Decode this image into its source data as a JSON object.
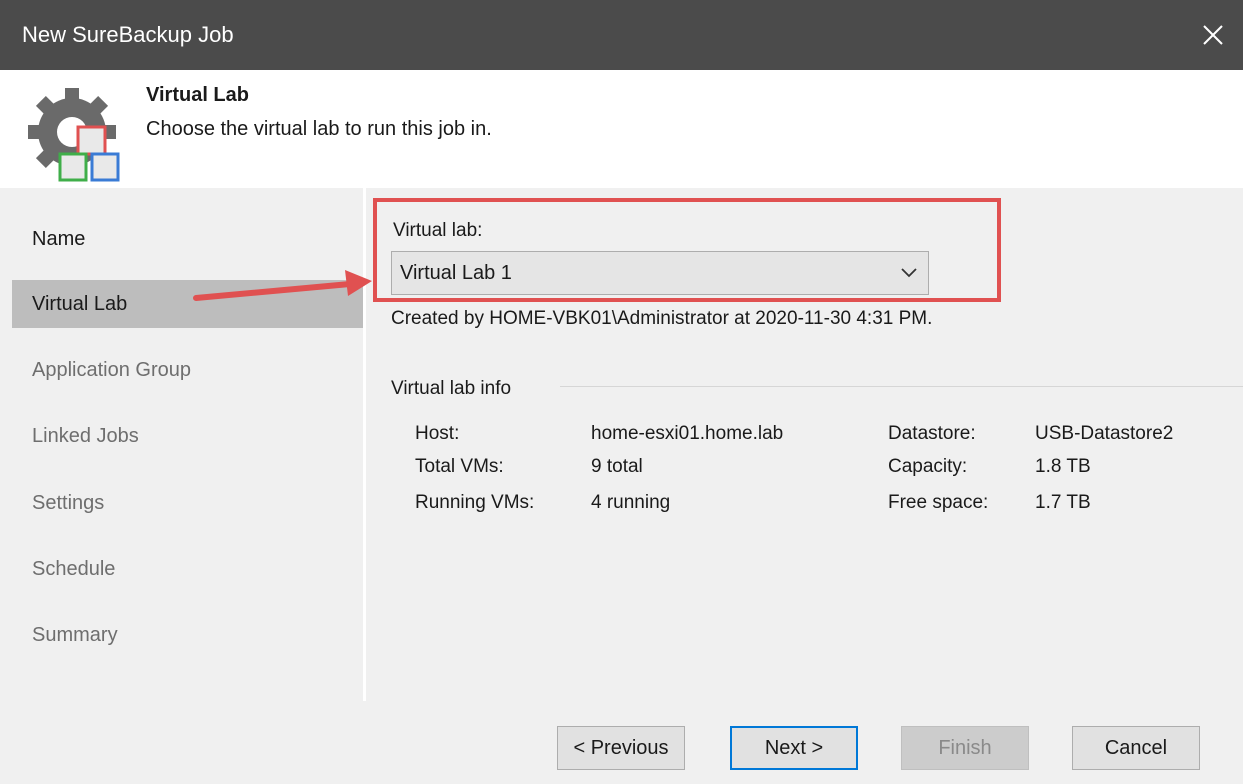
{
  "window": {
    "title": "New SureBackup Job",
    "close_icon": "close-icon"
  },
  "header": {
    "title": "Virtual Lab",
    "subtitle": "Choose the virtual lab to run this job in.",
    "logo_icon": "gear-with-boxes-icon"
  },
  "sidebar": {
    "items": [
      {
        "label": "Name",
        "state": "enabled"
      },
      {
        "label": "Virtual Lab",
        "state": "active"
      },
      {
        "label": "Application Group",
        "state": "disabled"
      },
      {
        "label": "Linked Jobs",
        "state": "disabled"
      },
      {
        "label": "Settings",
        "state": "disabled"
      },
      {
        "label": "Schedule",
        "state": "disabled"
      },
      {
        "label": "Summary",
        "state": "disabled"
      }
    ]
  },
  "main": {
    "virtual_lab_label": "Virtual lab:",
    "virtual_lab_value": "Virtual Lab 1",
    "created_by": "Created by HOME-VBK01\\Administrator at 2020-11-30 4:31 PM.",
    "info_group_title": "Virtual lab info",
    "info": {
      "host_label": "Host:",
      "host_value": "home-esxi01.home.lab",
      "total_vms_label": "Total VMs:",
      "total_vms_value": "9 total",
      "running_vms_label": "Running VMs:",
      "running_vms_value": "4 running",
      "datastore_label": "Datastore:",
      "datastore_value": "USB-Datastore2",
      "capacity_label": "Capacity:",
      "capacity_value": "1.8 TB",
      "free_space_label": "Free space:",
      "free_space_value": "1.7 TB"
    }
  },
  "buttons": {
    "previous": "< Previous",
    "next": "Next >",
    "finish": "Finish",
    "cancel": "Cancel"
  },
  "colors": {
    "titlebar": "#4b4b4b",
    "annotation_red": "#e05151",
    "default_button_border": "#0078d7"
  }
}
